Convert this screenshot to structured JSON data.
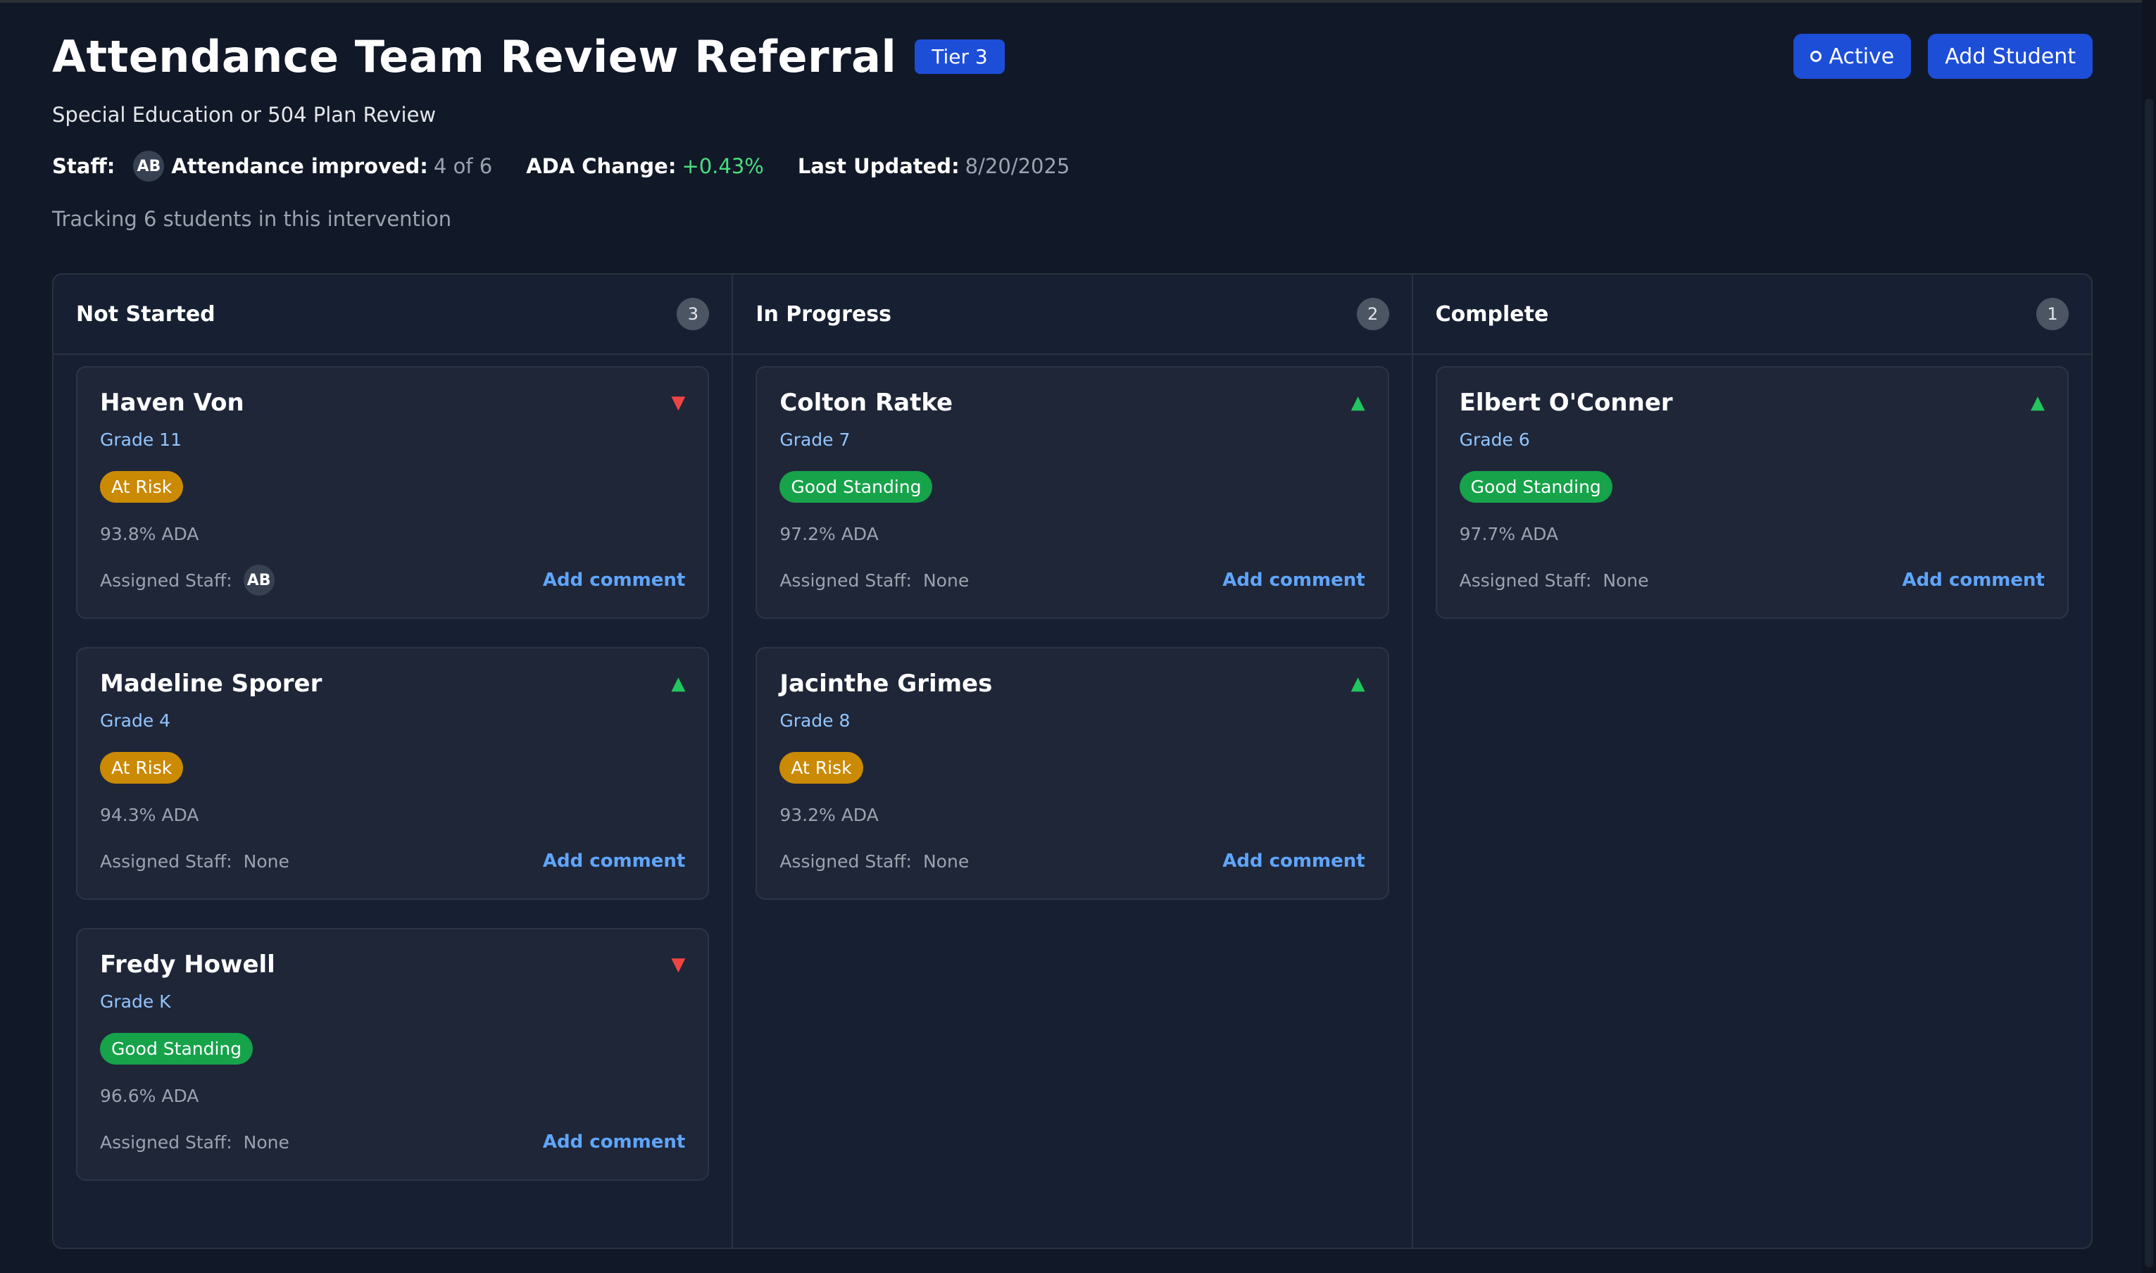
{
  "header": {
    "title": "Attendance Team Review Referral",
    "tier": "Tier 3",
    "active_label": "Active",
    "add_student_label": "Add Student"
  },
  "subtitle": "Special Education or 504 Plan Review",
  "meta": {
    "staff_label": "Staff:",
    "staff_initials": "AB",
    "improved_label": "Attendance improved:",
    "improved_value": "4 of 6",
    "ada_change_label": "ADA Change:",
    "ada_change_value": "+0.43%",
    "updated_label": "Last Updated:",
    "updated_value": "8/20/2025"
  },
  "tracking_text": "Tracking 6 students in this intervention",
  "colors": {
    "accent": "#1d4ed8",
    "at_risk": "#ca8a04",
    "good_standing": "#16a34a",
    "trend_up": "#22c55e",
    "trend_down": "#ef4444",
    "link": "#60a5fa"
  },
  "columns": [
    {
      "title": "Not Started",
      "count": "3",
      "cards": [
        {
          "name": "Haven Von",
          "grade": "Grade 11",
          "status": "At Risk",
          "ada": "93.8% ADA",
          "staff_label": "Assigned Staff:",
          "staff": "AB",
          "comment": "Add comment",
          "trend": "down"
        },
        {
          "name": "Madeline Sporer",
          "grade": "Grade 4",
          "status": "At Risk",
          "ada": "94.3% ADA",
          "staff_label": "Assigned Staff:",
          "staff": "None",
          "comment": "Add comment",
          "trend": "up"
        },
        {
          "name": "Fredy Howell",
          "grade": "Grade K",
          "status": "Good Standing",
          "ada": "96.6% ADA",
          "staff_label": "Assigned Staff:",
          "staff": "None",
          "comment": "Add comment",
          "trend": "down"
        }
      ]
    },
    {
      "title": "In Progress",
      "count": "2",
      "cards": [
        {
          "name": "Colton Ratke",
          "grade": "Grade 7",
          "status": "Good Standing",
          "ada": "97.2% ADA",
          "staff_label": "Assigned Staff:",
          "staff": "None",
          "comment": "Add comment",
          "trend": "up"
        },
        {
          "name": "Jacinthe Grimes",
          "grade": "Grade 8",
          "status": "At Risk",
          "ada": "93.2% ADA",
          "staff_label": "Assigned Staff:",
          "staff": "None",
          "comment": "Add comment",
          "trend": "up"
        }
      ]
    },
    {
      "title": "Complete",
      "count": "1",
      "cards": [
        {
          "name": "Elbert O'Conner",
          "grade": "Grade 6",
          "status": "Good Standing",
          "ada": "97.7% ADA",
          "staff_label": "Assigned Staff:",
          "staff": "None",
          "comment": "Add comment",
          "trend": "up"
        }
      ]
    }
  ]
}
